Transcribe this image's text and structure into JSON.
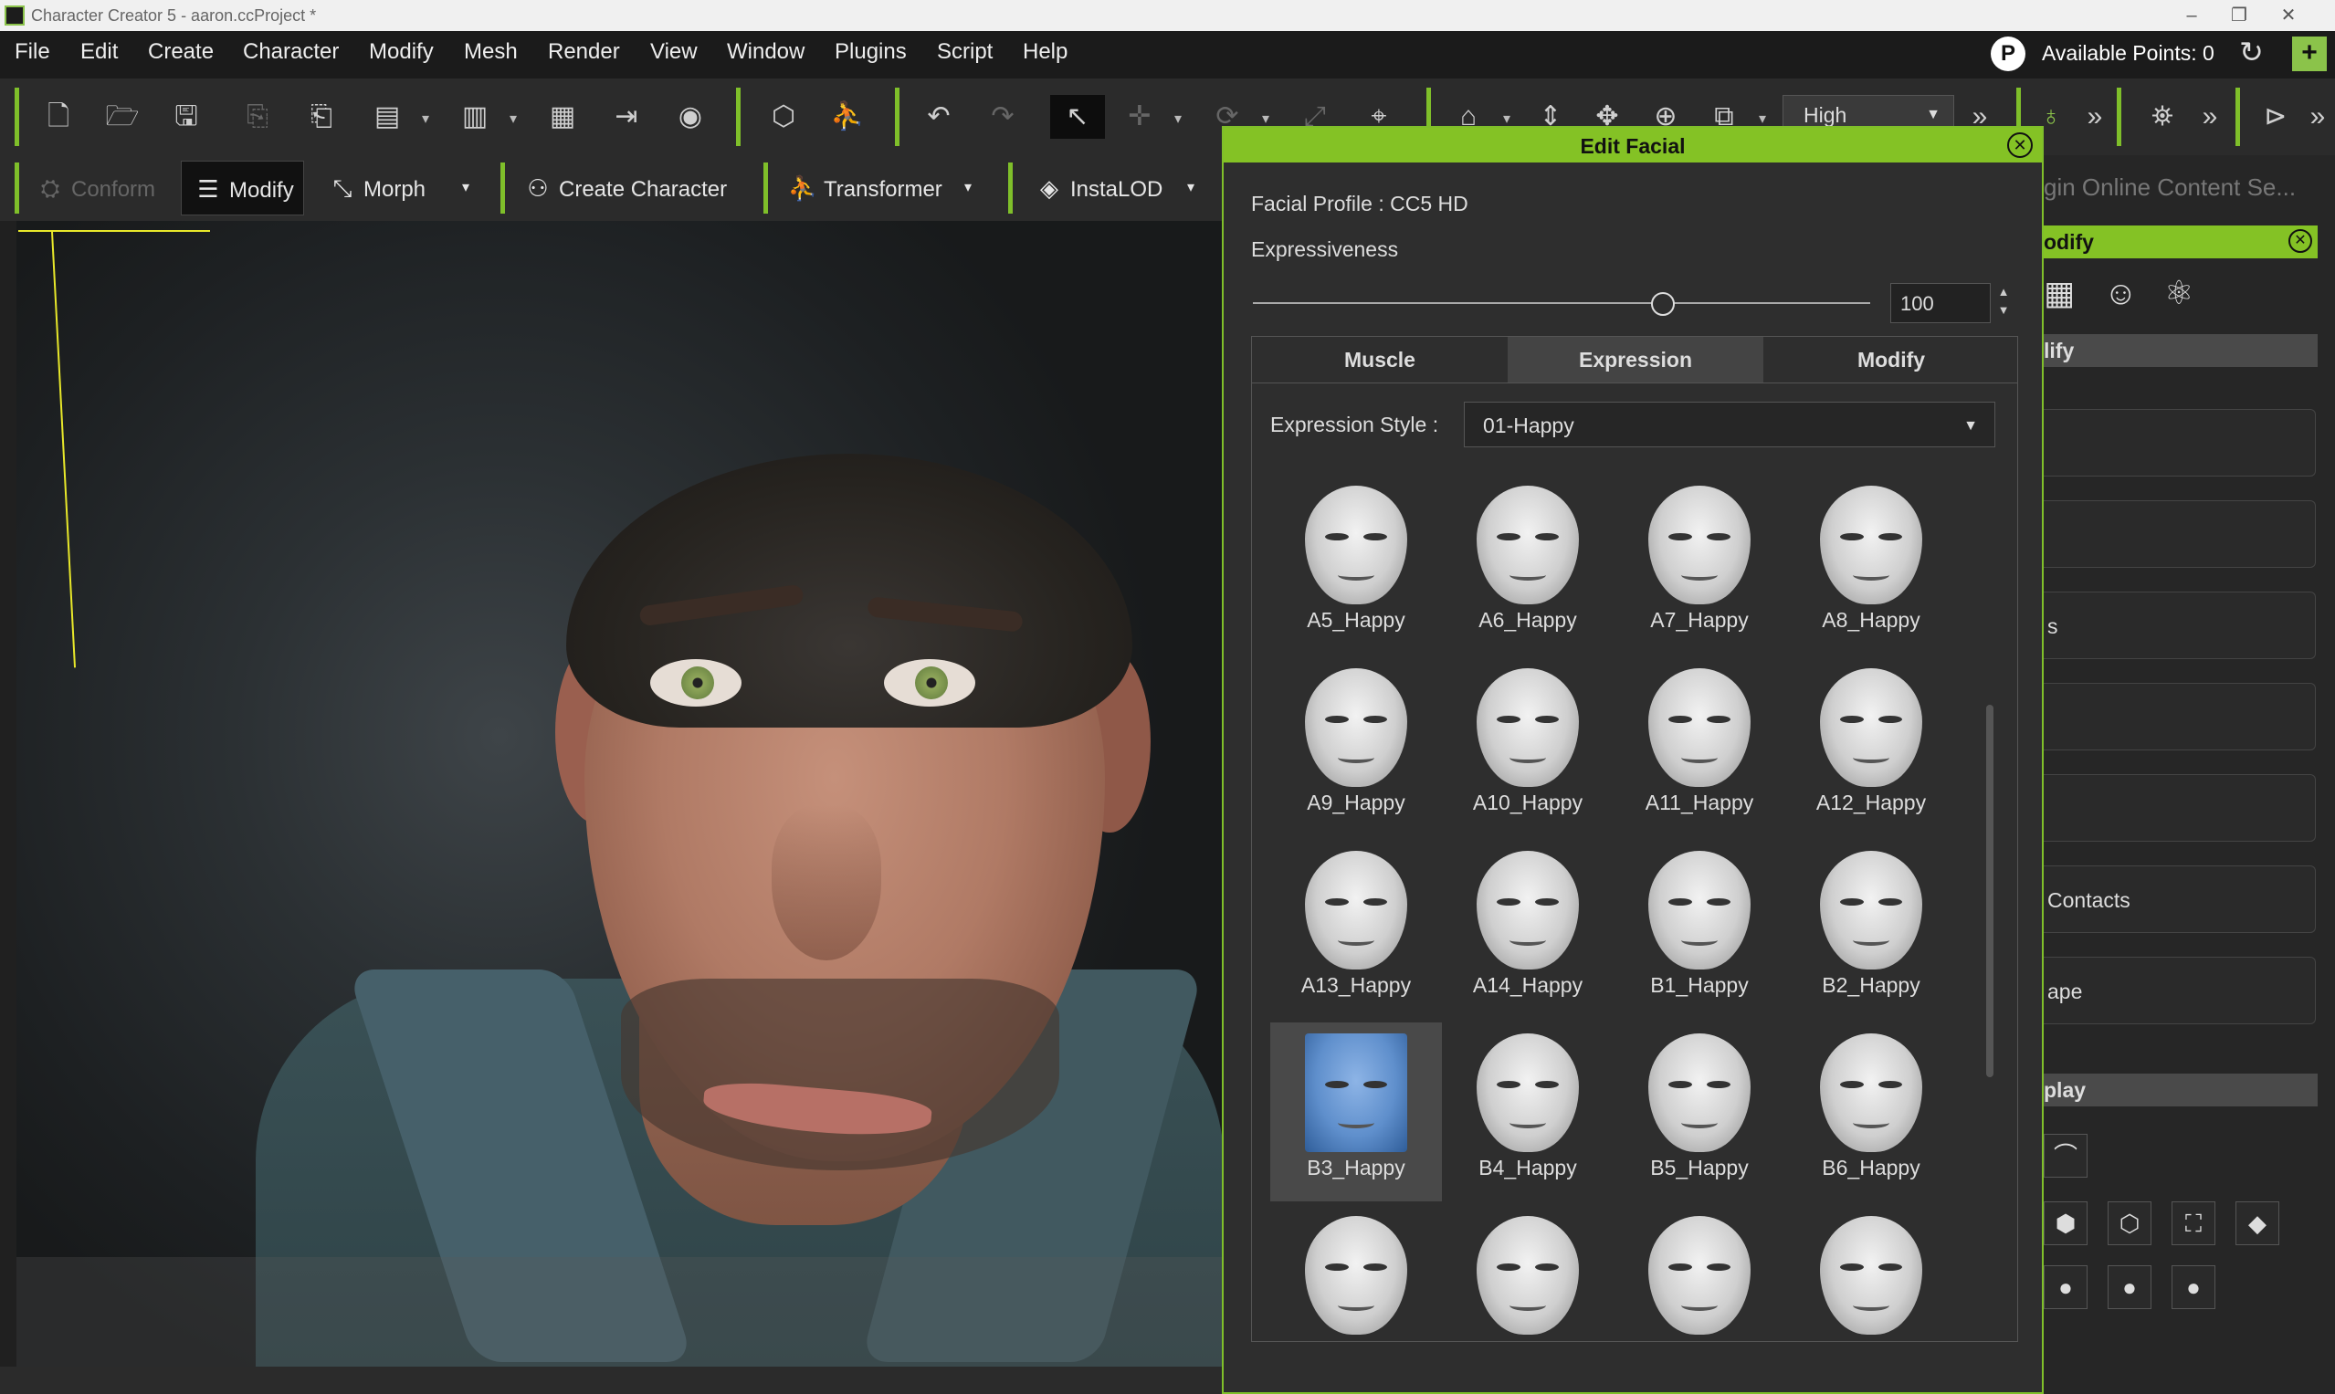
{
  "window": {
    "title": "Character Creator 5 - aaron.ccProject *",
    "minimize": "–",
    "restore": "❐",
    "close": "✕"
  },
  "menu": [
    "File",
    "Edit",
    "Create",
    "Character",
    "Modify",
    "Mesh",
    "Render",
    "View",
    "Window",
    "Plugins",
    "Script",
    "Help"
  ],
  "account": {
    "points_icon": "P",
    "points_label": "Available Points: 0",
    "refresh_icon": "↻",
    "add_icon": "+"
  },
  "toolbar": {
    "quality_value": "High",
    "more1": "»",
    "more2": "»",
    "more3": "»",
    "more4": "»"
  },
  "toolbar2": {
    "conform": "Conform",
    "modify": "Modify",
    "morph": "Morph",
    "create_character": "Create Character",
    "transformer": "Transformer",
    "instalod": "InstaLOD"
  },
  "edit_facial": {
    "title": "Edit Facial",
    "profile_label": "Facial Profile : CC5 HD",
    "expressiveness_label": "Expressiveness",
    "expressiveness_value": "100",
    "expressiveness_fraction": 1.0,
    "tabs": [
      "Muscle",
      "Expression",
      "Modify"
    ],
    "active_tab": "Expression",
    "expression_style_label": "Expression Style :",
    "expression_style_value": "01-Happy",
    "expressions": [
      "A5_Happy",
      "A6_Happy",
      "A7_Happy",
      "A8_Happy",
      "A9_Happy",
      "A10_Happy",
      "A11_Happy",
      "A12_Happy",
      "A13_Happy",
      "A14_Happy",
      "B1_Happy",
      "B2_Happy",
      "B3_Happy",
      "B4_Happy",
      "B5_Happy",
      "B6_Happy",
      "",
      "",
      "",
      ""
    ],
    "selected_expression": "B3_Happy"
  },
  "right_panel": {
    "online_search": "gin Online Content Se...",
    "modify_header": "odify",
    "modify_section": "lify",
    "rows": [
      "",
      "",
      "s",
      "",
      "",
      "Contacts",
      "ape"
    ],
    "display_section": "play"
  }
}
